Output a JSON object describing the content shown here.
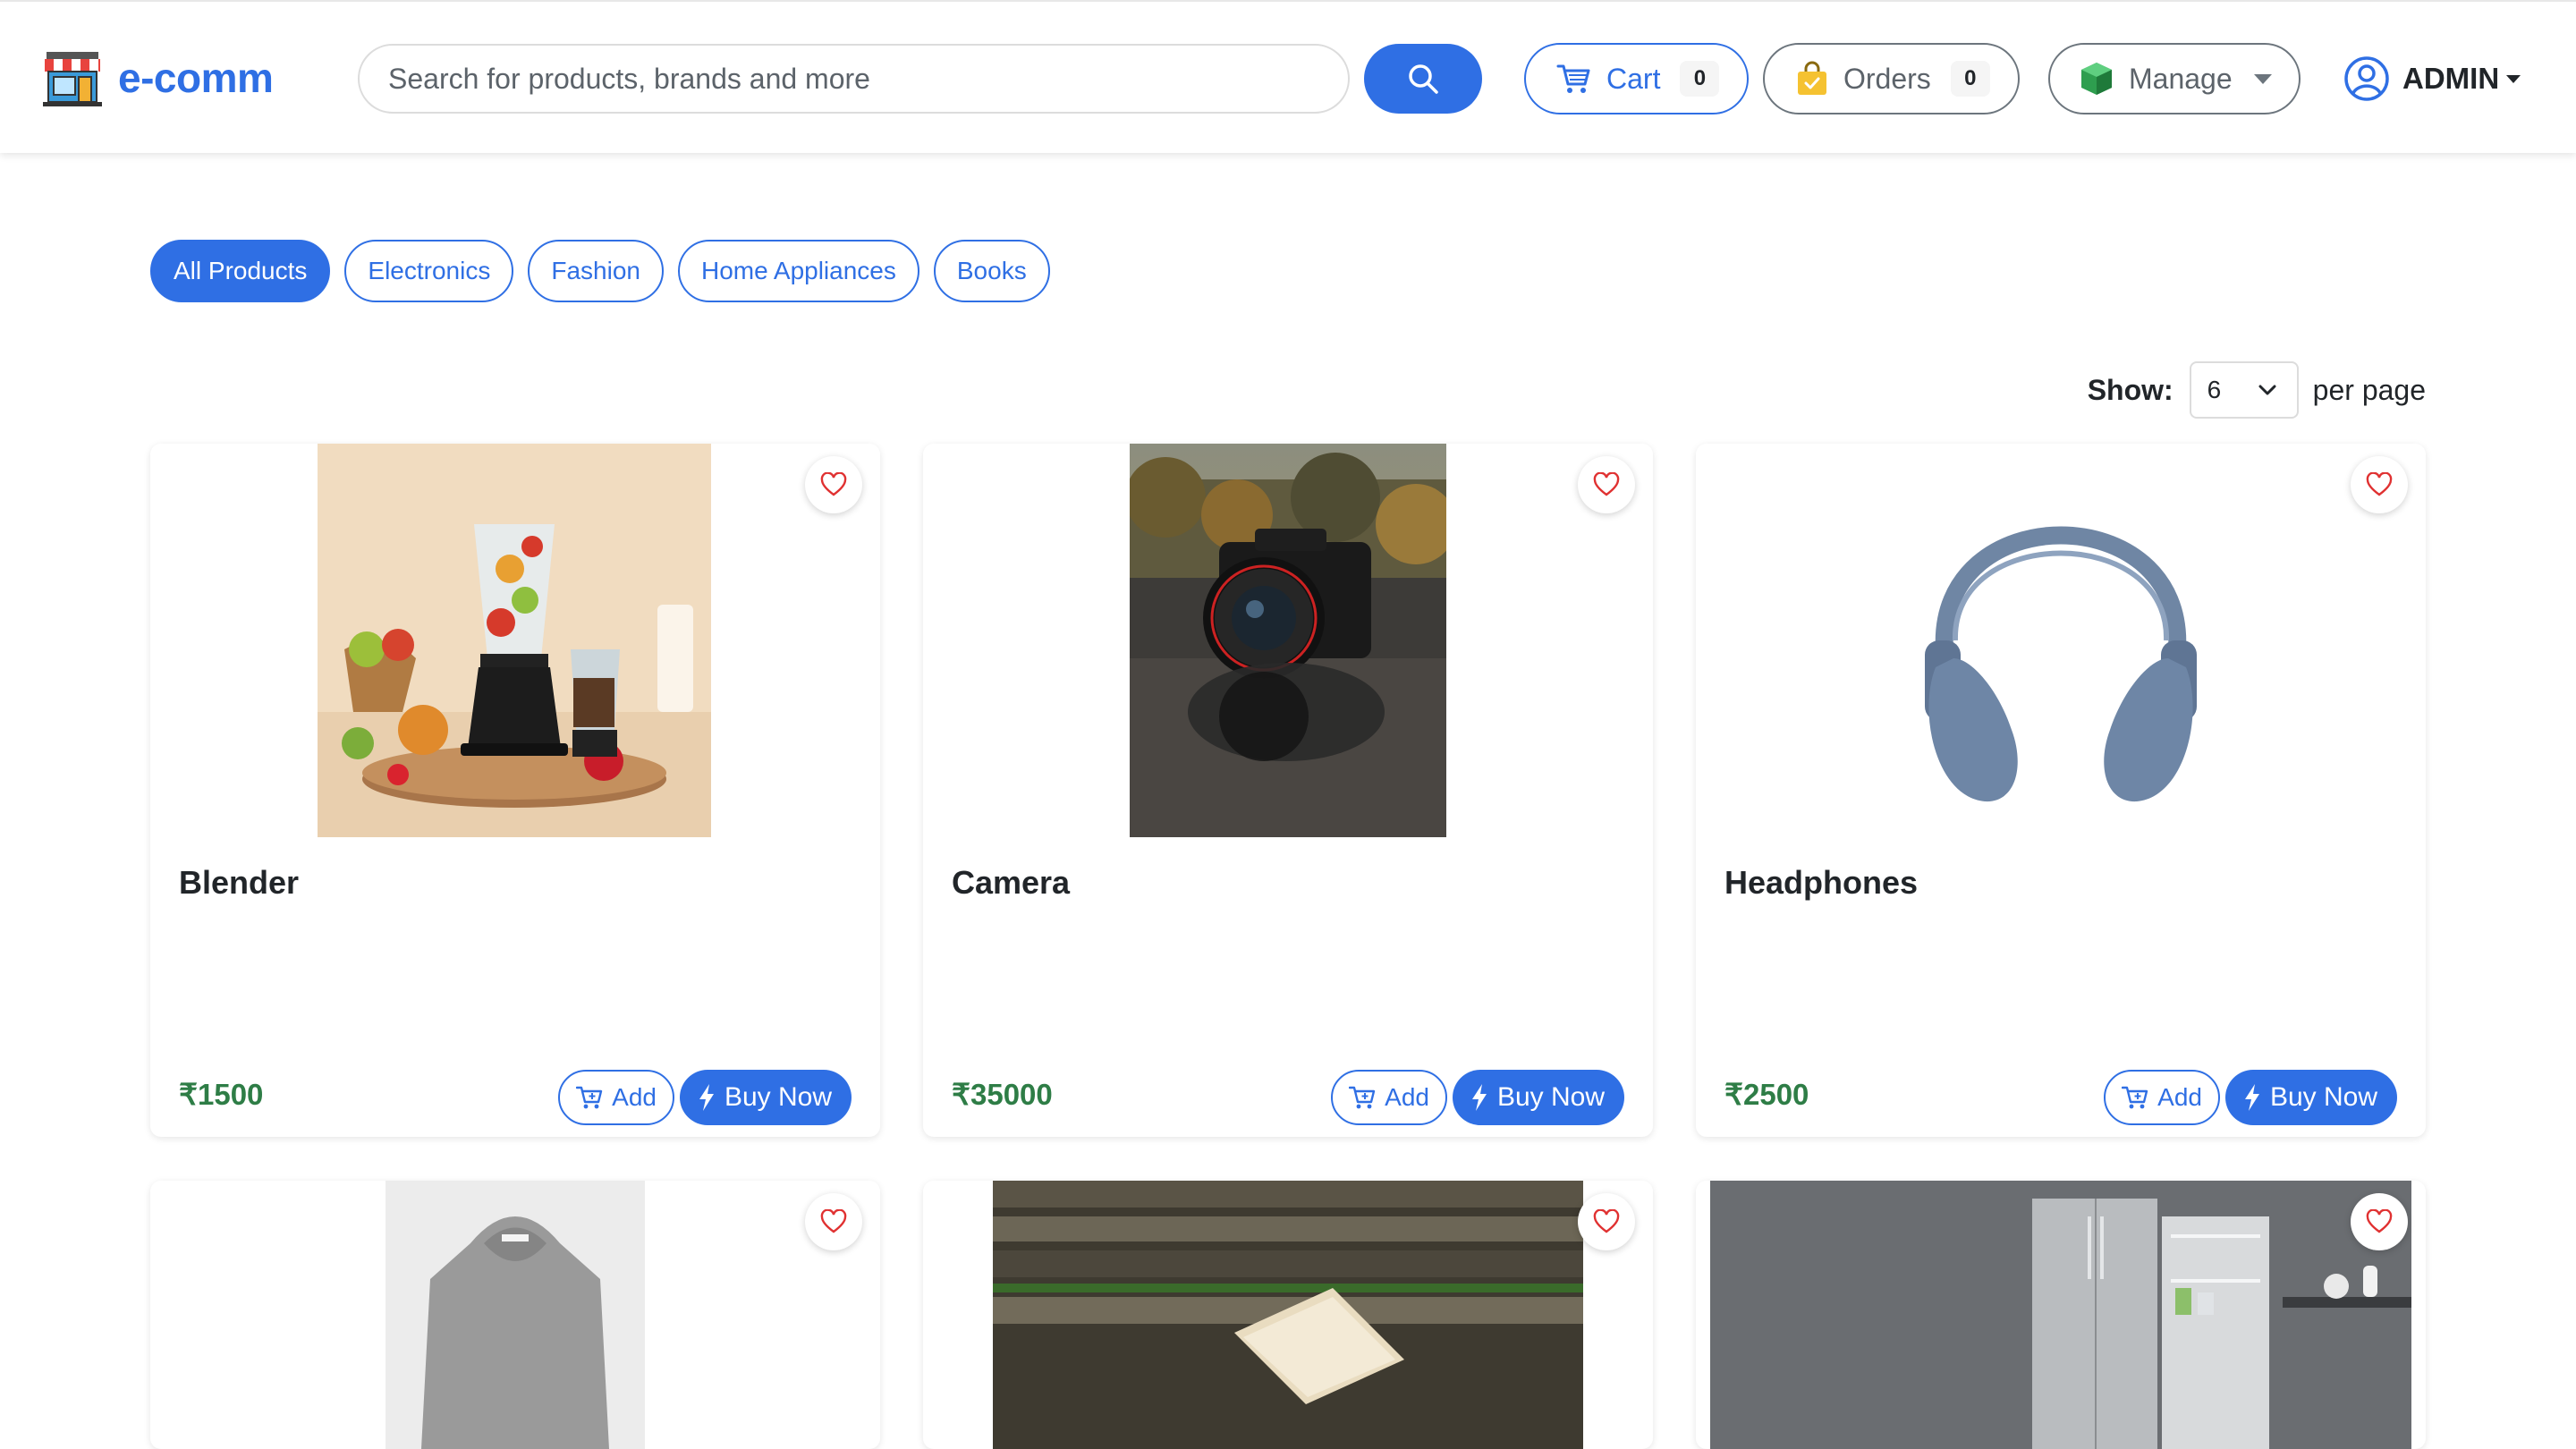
{
  "brand": {
    "name": "e-comm"
  },
  "search": {
    "placeholder": "Search for products, brands and more"
  },
  "nav": {
    "cart_label": "Cart",
    "cart_count": "0",
    "orders_label": "Orders",
    "orders_count": "0",
    "manage_label": "Manage",
    "user_label": "ADMIN"
  },
  "categories": [
    {
      "label": "All Products",
      "active": true
    },
    {
      "label": "Electronics",
      "active": false
    },
    {
      "label": "Fashion",
      "active": false
    },
    {
      "label": "Home Appliances",
      "active": false
    },
    {
      "label": "Books",
      "active": false
    }
  ],
  "pagination": {
    "show_label": "Show:",
    "per_page_value": "6",
    "per_page_label": "per page"
  },
  "product_actions": {
    "add_label": "Add",
    "buy_label": "Buy Now"
  },
  "products": [
    {
      "name": "Blender",
      "price": "₹1500"
    },
    {
      "name": "Camera",
      "price": "₹35000"
    },
    {
      "name": "Headphones",
      "price": "₹2500"
    }
  ],
  "colors": {
    "primary": "#2f6fe4",
    "price": "#2e7d46",
    "wishlist": "#e03131"
  }
}
